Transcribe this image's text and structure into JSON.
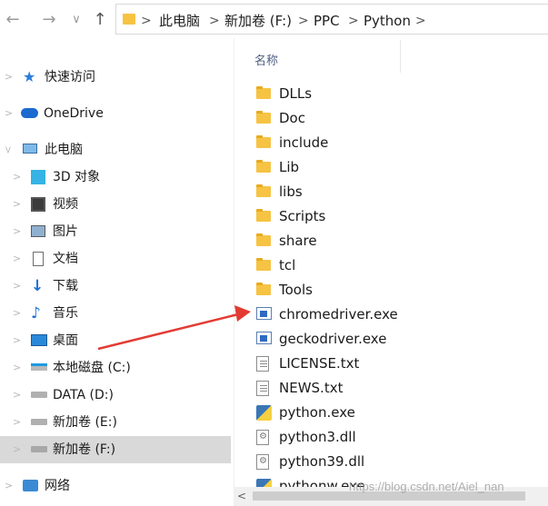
{
  "toolbar": {
    "back_icon": "←",
    "forward_icon": "→",
    "recent_icon": "∨",
    "up_icon": "↑"
  },
  "breadcrumb": {
    "items": [
      "此电脑",
      "新加卷 (F:)",
      "PPC",
      "Python"
    ],
    "separator": ">"
  },
  "sidebar": {
    "items": [
      {
        "label": "快速访问",
        "icon": "star-icon"
      },
      {
        "label": "OneDrive",
        "icon": "cloud-icon"
      },
      {
        "label": "此电脑",
        "icon": "computer-icon"
      },
      {
        "label": "3D 对象",
        "icon": "cube-icon"
      },
      {
        "label": "视频",
        "icon": "video-icon"
      },
      {
        "label": "图片",
        "icon": "picture-icon"
      },
      {
        "label": "文档",
        "icon": "document-icon"
      },
      {
        "label": "下载",
        "icon": "download-icon"
      },
      {
        "label": "音乐",
        "icon": "music-icon"
      },
      {
        "label": "桌面",
        "icon": "desktop-icon"
      },
      {
        "label": "本地磁盘 (C:)",
        "icon": "drive-windows-icon"
      },
      {
        "label": "DATA (D:)",
        "icon": "drive-icon"
      },
      {
        "label": "新加卷 (E:)",
        "icon": "drive-icon"
      },
      {
        "label": "新加卷 (F:)",
        "icon": "drive-icon",
        "selected": true
      },
      {
        "label": "网络",
        "icon": "network-icon"
      }
    ]
  },
  "file_list": {
    "column_name": "名称",
    "rows": [
      {
        "name": "DLLs",
        "type": "folder"
      },
      {
        "name": "Doc",
        "type": "folder"
      },
      {
        "name": "include",
        "type": "folder"
      },
      {
        "name": "Lib",
        "type": "folder"
      },
      {
        "name": "libs",
        "type": "folder"
      },
      {
        "name": "Scripts",
        "type": "folder"
      },
      {
        "name": "share",
        "type": "folder"
      },
      {
        "name": "tcl",
        "type": "folder"
      },
      {
        "name": "Tools",
        "type": "folder"
      },
      {
        "name": "chromedriver.exe",
        "type": "exe"
      },
      {
        "name": "geckodriver.exe",
        "type": "exe"
      },
      {
        "name": "LICENSE.txt",
        "type": "txt"
      },
      {
        "name": "NEWS.txt",
        "type": "txt"
      },
      {
        "name": "python.exe",
        "type": "python"
      },
      {
        "name": "python3.dll",
        "type": "dll"
      },
      {
        "name": "python39.dll",
        "type": "dll"
      },
      {
        "name": "pythonw.exe",
        "type": "python"
      }
    ]
  },
  "watermark": "https://blog.csdn.net/Aiel_nan",
  "colors": {
    "selected_bg": "#d9d9d9",
    "arrow": "#e33b32",
    "folder": "#f6c343"
  }
}
